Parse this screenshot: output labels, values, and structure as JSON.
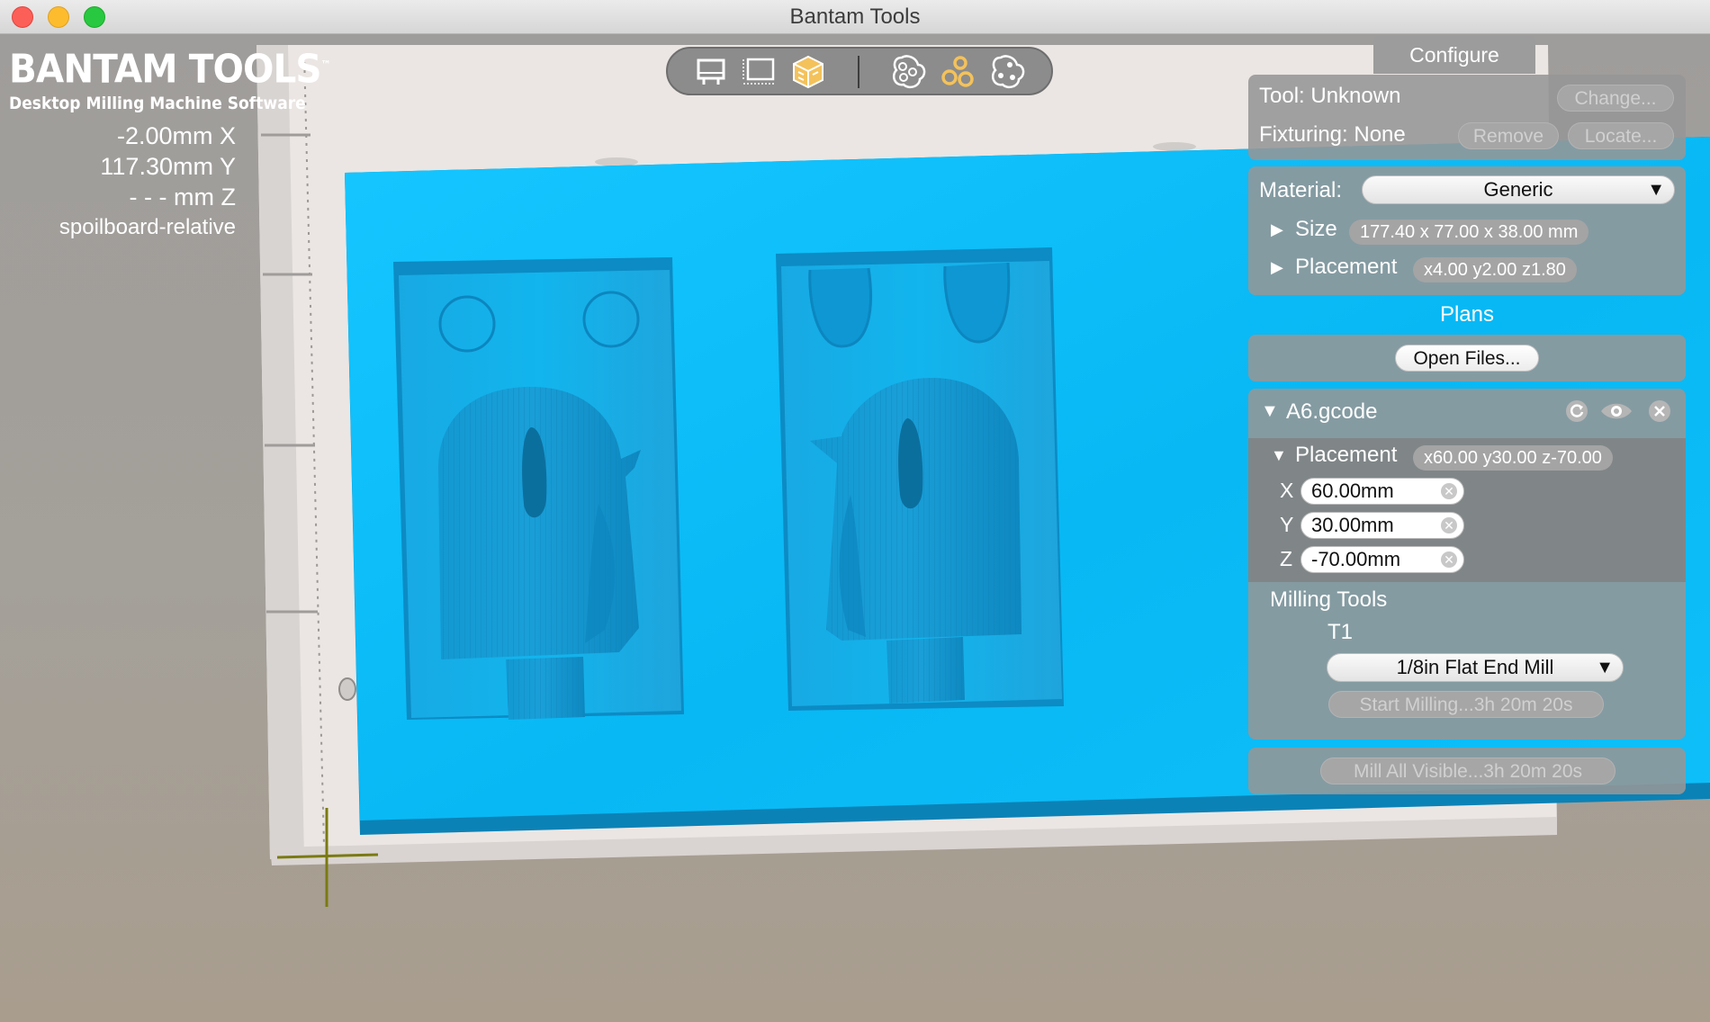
{
  "window": {
    "title": "Bantam Tools"
  },
  "brand": {
    "name": "BANTAM TOOLS",
    "tm": "™",
    "subtitle": "Desktop Milling Machine Software"
  },
  "coords": {
    "x": "-2.00mm X",
    "y": "117.30mm Y",
    "z": "- - - mm Z",
    "mode": "spoilboard-relative"
  },
  "view_toolbar": {
    "icons": [
      "top-view-icon",
      "front-view-icon",
      "iso-view-icon",
      "toolpath-view-1-icon",
      "toolpath-view-2-icon",
      "toolpath-view-3-icon"
    ]
  },
  "configure": {
    "tab_label": "Configure",
    "tool_label": "Tool: Unknown",
    "change_label": "Change...",
    "fixturing_label": "Fixturing: None",
    "remove_label": "Remove",
    "locate_label": "Locate...",
    "material_label": "Material:",
    "material_value": "Generic",
    "size_label": "Size",
    "size_value": "177.40 x 77.00 x 38.00 mm",
    "placement_label": "Placement",
    "placement_value": "x4.00 y2.00 z1.80"
  },
  "plans": {
    "title": "Plans",
    "open_files_label": "Open Files...",
    "file": {
      "name": "A6.gcode",
      "placement_label": "Placement",
      "placement_value": "x60.00 y30.00 z-70.00",
      "x_label": "X",
      "x_value": "60.00mm",
      "y_label": "Y",
      "y_value": "30.00mm",
      "z_label": "Z",
      "z_value": "-70.00mm",
      "milling_tools_label": "Milling Tools",
      "tool_id": "T1",
      "tool_value": "1/8in Flat End Mill",
      "start_label": "Start Milling...3h 20m 20s"
    },
    "mill_all_label": "Mill All Visible...3h 20m 20s"
  },
  "colors": {
    "stock": "#10c4ff",
    "stock_dark": "#0b90c5",
    "bed": "#ece7e4",
    "panel": "#969696"
  }
}
